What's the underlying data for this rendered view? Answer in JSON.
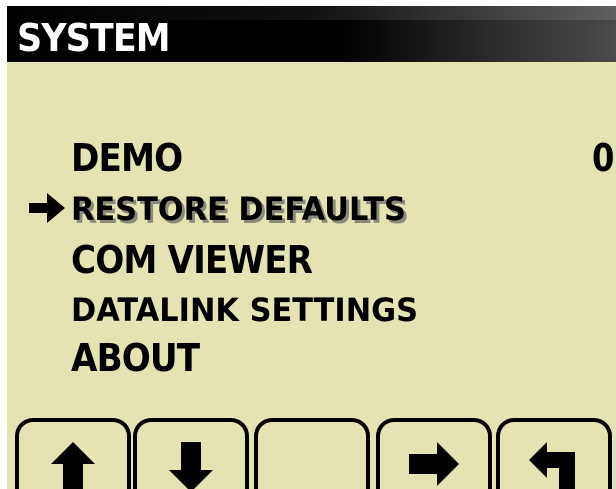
{
  "header": {
    "title": "SYSTEM"
  },
  "menu": {
    "items": [
      {
        "label": "DEMO",
        "value": "0",
        "selected": false
      },
      {
        "label": "RESTORE DEFAULTS",
        "value": "",
        "selected": true
      },
      {
        "label": "COM VIEWER",
        "value": "",
        "selected": false
      },
      {
        "label": "DATALINK SETTINGS",
        "value": "",
        "selected": false
      },
      {
        "label": "ABOUT",
        "value": "",
        "selected": false
      }
    ],
    "cursor_icon": "right-arrow-icon"
  },
  "softkeys": [
    {
      "icon": "up-arrow-icon"
    },
    {
      "icon": "down-arrow-icon"
    },
    {
      "icon": ""
    },
    {
      "icon": "right-arrow-icon"
    },
    {
      "icon": "back-return-icon"
    }
  ],
  "colors": {
    "lcd_background": "#e6e3b3",
    "header_background": "#000000",
    "text": "#000000",
    "title_text": "#ffffff"
  }
}
